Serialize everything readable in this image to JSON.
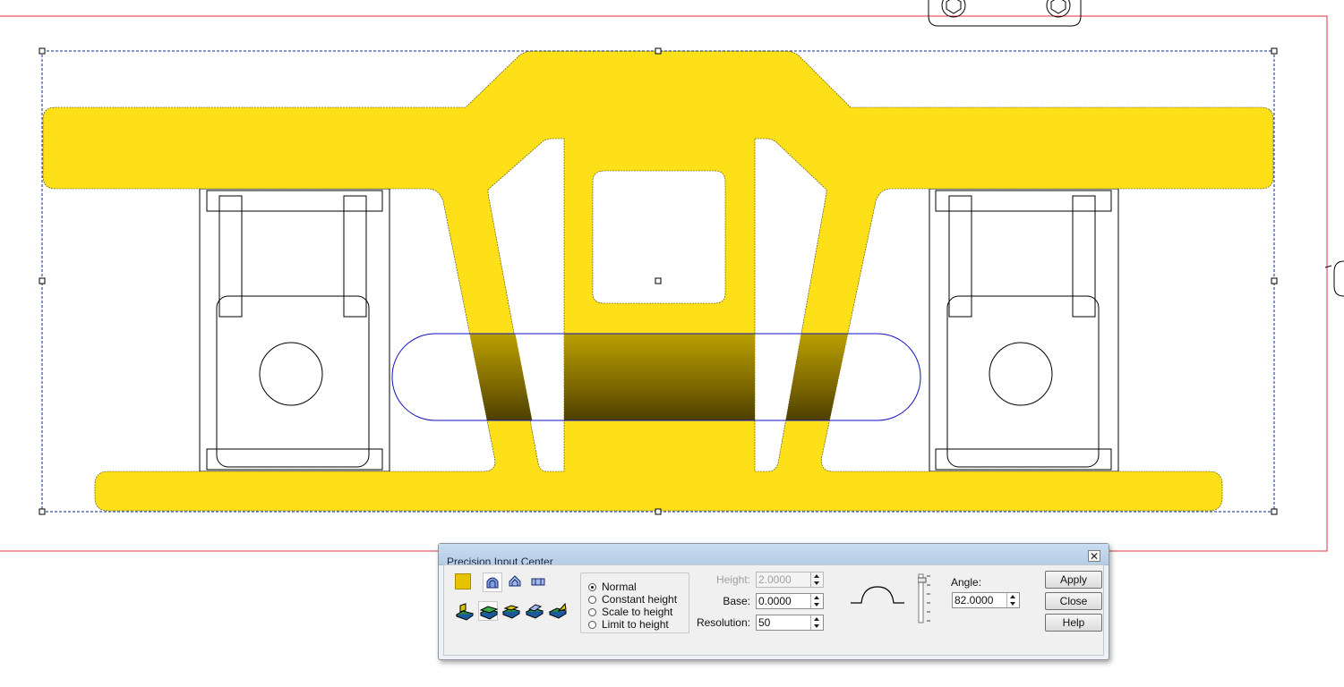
{
  "dialog": {
    "title": "Precision Input Center",
    "close_glyph": "✕",
    "color_swatch": "#e8c400",
    "shape_icons": [
      "round-dome-icon",
      "pointed-dome-icon",
      "flat-bar-icon"
    ],
    "mode_icons": [
      "extrude-icon",
      "layer-green-icon",
      "layer-stack-icon",
      "layer-slant-icon",
      "layer-wedge-icon"
    ],
    "height_options": [
      {
        "label": "Normal",
        "selected": true
      },
      {
        "label": "Constant height",
        "selected": false
      },
      {
        "label": "Scale to height",
        "selected": false
      },
      {
        "label": "Limit to height",
        "selected": false
      }
    ],
    "height_label": "Height:",
    "height_value": "2.0000",
    "base_label": "Base:",
    "base_value": "0.0000",
    "resolution_label": "Resolution:",
    "resolution_value": "50",
    "angle_label": "Angle:",
    "angle_value": "82.0000",
    "buttons": {
      "apply": "Apply",
      "close": "Close",
      "help": "Help"
    }
  },
  "colors": {
    "part_fill": "#fde018",
    "boundary": "#e0303c",
    "selection": "#0a2a8a",
    "slot_outline": "#1010c0"
  }
}
